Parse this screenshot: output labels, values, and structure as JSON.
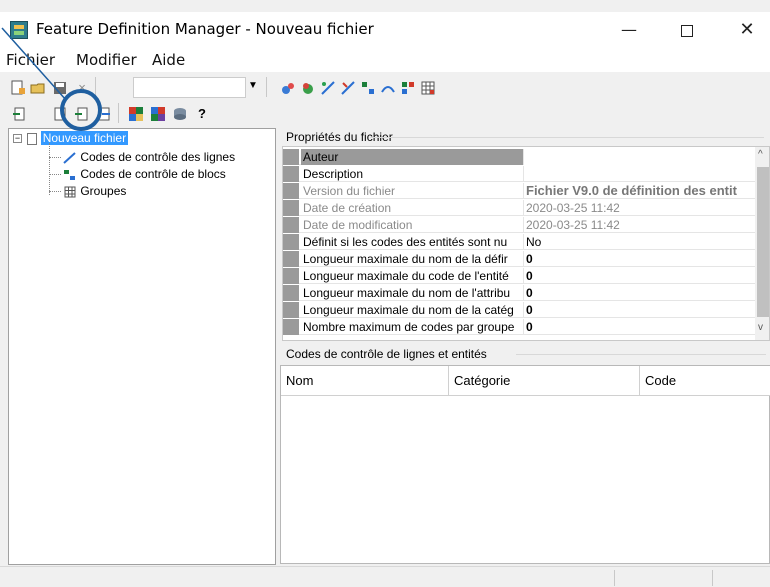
{
  "window": {
    "title": "Feature Definition Manager - Nouveau fichier",
    "minimize": "—",
    "close": "✕"
  },
  "menu": {
    "items": [
      "Fichier",
      "Modifier",
      "Aide"
    ]
  },
  "toolbar": {
    "close_glyph": "×",
    "help_glyph": "?"
  },
  "tree": {
    "root": "Nouveau fichier",
    "children": [
      "Codes de contrôle des lignes",
      "Codes de contrôle de blocs",
      "Groupes"
    ]
  },
  "properties": {
    "section_label": "Propriétés du fichier",
    "rows": [
      {
        "name": "Auteur",
        "value": ""
      },
      {
        "name": "Description",
        "value": ""
      },
      {
        "name": "Version du fichier",
        "value": "Fichier V9.0 de définition des entit"
      },
      {
        "name": "Date de création",
        "value": "2020-03-25 11:42"
      },
      {
        "name": "Date de modification",
        "value": "2020-03-25 11:42"
      },
      {
        "name": "Définit si les codes des entités sont nu",
        "value": "No"
      },
      {
        "name": "Longueur maximale du nom de la défir",
        "value": "0"
      },
      {
        "name": "Longueur maximale du code de l'entité",
        "value": "0"
      },
      {
        "name": "Longueur maximale du nom de l'attribu",
        "value": "0"
      },
      {
        "name": "Longueur maximale du nom de la catég",
        "value": "0"
      },
      {
        "name": "Nombre maximum de codes par groupe",
        "value": "0"
      }
    ],
    "scroll_up": "^",
    "scroll_down": "v"
  },
  "codes": {
    "section_label": "Codes de contrôle de lignes et entités",
    "columns": [
      "Nom",
      "Catégorie",
      "Code"
    ]
  },
  "colors": {
    "selection": "#3399ff",
    "highlight_circle": "#1f5fa0"
  }
}
